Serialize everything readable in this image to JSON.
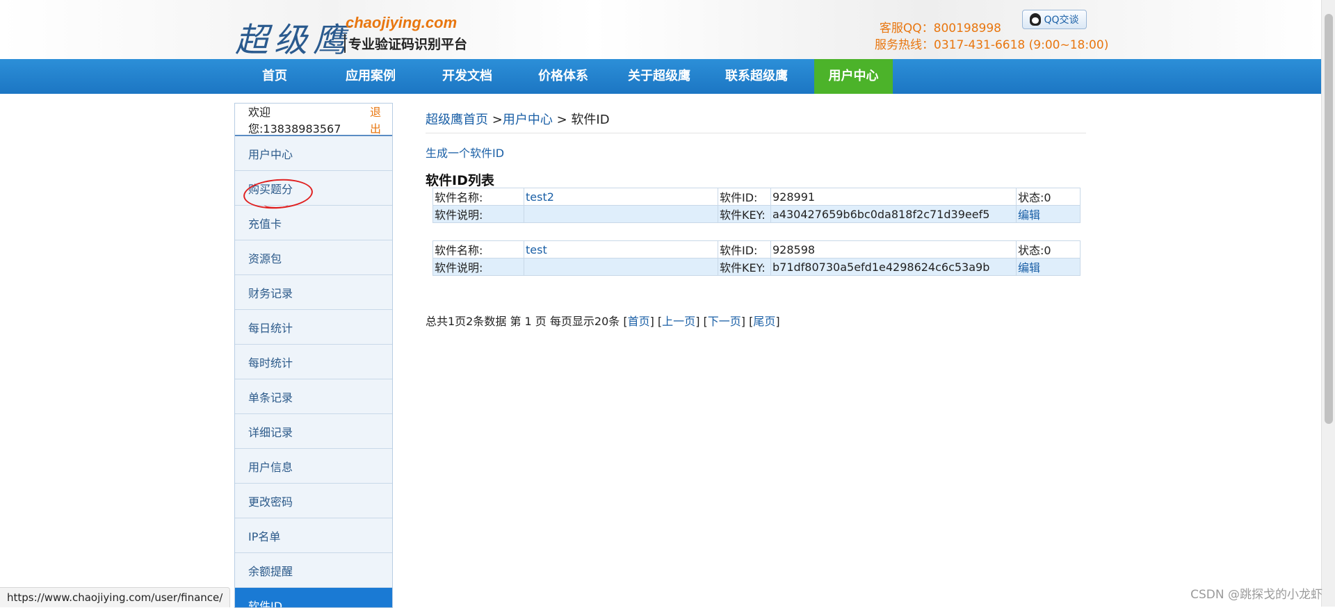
{
  "header": {
    "logo_cn": "超级鹰",
    "logo_en": "chaojiying.com",
    "logo_sub": "专业验证码识别平台",
    "qq": "客服QQ：800198998",
    "qq_button": "QQ交谈",
    "hotline": "服务热线：0317-431-6618 (9:00~18:00)"
  },
  "nav": [
    "首页",
    "应用案例",
    "开发文档",
    "价格体系",
    "关于超级鹰",
    "联系超级鹰",
    "用户中心"
  ],
  "sidebar": {
    "welcome": "欢迎您:13838983567",
    "logout": "退出",
    "items": [
      "用户中心",
      "购买题分",
      "充值卡",
      "资源包",
      "财务记录",
      "每日统计",
      "每时统计",
      "单条记录",
      "详细记录",
      "用户信息",
      "更改密码",
      "IP名单",
      "余额提醒",
      "软件ID"
    ]
  },
  "breadcrumb": {
    "home": "超级鹰首页",
    "sep1": ">",
    "center": "用户中心",
    "sep2": ">",
    "current": "软件ID"
  },
  "gen_link": "生成一个软件ID",
  "list_title": "软件ID列表",
  "labels": {
    "name": "软件名称:",
    "desc": "软件说明:",
    "id": "软件ID:",
    "key": "软件KEY:",
    "edit": "编辑"
  },
  "software": [
    {
      "name": "test2",
      "desc": "",
      "id": "928991",
      "key": "a430427659b6bc0da818f2c71d39eef5",
      "status": "状态:0"
    },
    {
      "name": "test",
      "desc": "",
      "id": "928598",
      "key": "b71df80730a5efd1e4298624c6c53a9b",
      "status": "状态:0"
    }
  ],
  "pager": {
    "summary": "总共1页2条数据 第 1 页 每页显示20条",
    "first": "首页",
    "prev": "上一页",
    "next": "下一页",
    "last": "尾页"
  },
  "statusbar": "https://www.chaojiying.com/user/finance/",
  "watermark": "CSDN @跳探戈的小龙虾",
  "colors": {
    "nav": "#1c76c3",
    "nav_active": "#4cb32a",
    "accent_orange": "#e8760f",
    "link": "#1a5fa6",
    "annotation_red": "#e02020"
  }
}
